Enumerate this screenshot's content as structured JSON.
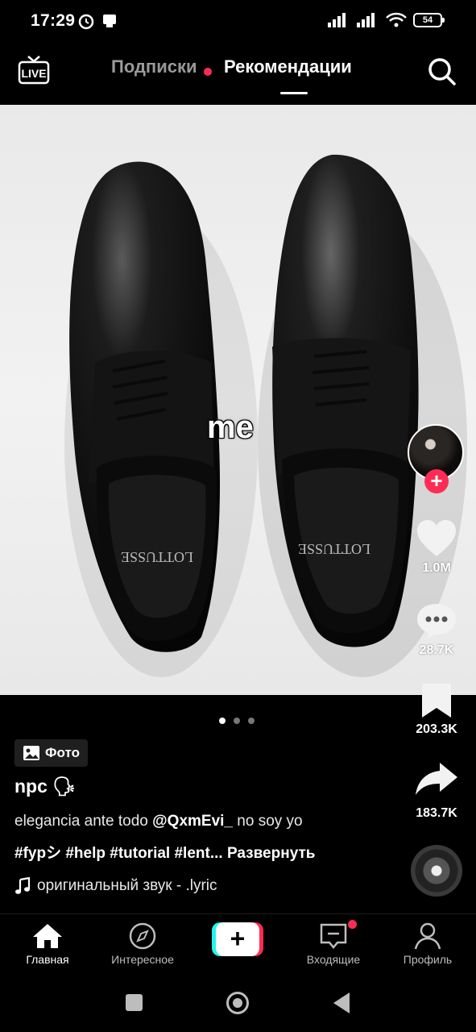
{
  "status_bar": {
    "time": "17:29",
    "battery": "54"
  },
  "top_nav": {
    "live_label": "LIVE",
    "tab_following": "Подписки",
    "tab_for_you": "Рекомендации"
  },
  "post": {
    "overlay_text": "me",
    "slides_total": 3,
    "slide_active": 1,
    "badge": "Фото",
    "username": "npc",
    "username_emoji": "🗣",
    "caption_text": "elegancia ante todo ",
    "caption_mention": "@QxmEvi_",
    "caption_tail": "  no soy yo",
    "hashtags": "#fypシ #help #tutorial #lent...",
    "expand": "Развернуть",
    "music": "оригинальный звук - .lyric",
    "brand_on_shoe": "LOTTUSSE"
  },
  "rail": {
    "likes": "1.0M",
    "comments": "28.7K",
    "saves": "203.3K",
    "shares": "183.7K"
  },
  "bottom_bar": {
    "home": "Главная",
    "discover": "Интересное",
    "inbox": "Входящие",
    "profile": "Профиль"
  },
  "colors": {
    "accent": "#fe2c55",
    "cyan": "#25f4ee",
    "background": "#000000"
  }
}
